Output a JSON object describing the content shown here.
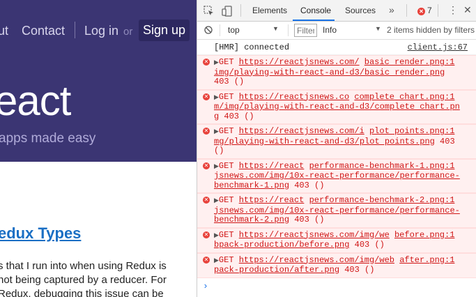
{
  "site": {
    "nav": {
      "about": "ut",
      "contact": "Contact",
      "login": "Log in",
      "or": "or",
      "signup": "Sign up"
    },
    "hero_title": "eact",
    "hero_subtitle": "apps made easy",
    "post_title": "edux Types",
    "post_lines": [
      "s that I run into when using Redux is",
      "not being captured by a reducer. For",
      "Redux, debugging this issue can be"
    ]
  },
  "devtools": {
    "tabs": [
      "Elements",
      "Console",
      "Sources"
    ],
    "active_tab": "Console",
    "more_tabs": "»",
    "error_count": "7",
    "context": "top",
    "filter_placeholder": "Filter",
    "level": "Info",
    "hidden_info": "2 items hidden by filters",
    "log": {
      "text": "[HMR] connected",
      "source": "client.js:67"
    },
    "errors": [
      {
        "lines": [
          [
            {
              "t": "GET "
            },
            {
              "t": "https://reactjsnews.com/",
              "u": true
            },
            {
              "t": " "
            },
            {
              "t": "basic render.png:1",
              "u": true
            }
          ],
          [
            {
              "t": "img/playing-with-react-and-d3/basic render.png",
              "u": true
            }
          ],
          [
            {
              "t": "403 ()"
            }
          ]
        ]
      },
      {
        "lines": [
          [
            {
              "t": "GET "
            },
            {
              "t": "https://reactjsnews.co",
              "u": true
            },
            {
              "t": " "
            },
            {
              "t": "complete chart.png:1",
              "u": true
            }
          ],
          [
            {
              "t": "m/img/playing-with-react-and-d3/complete chart.pn",
              "u": true
            }
          ],
          [
            {
              "t": "g",
              "u": true
            },
            {
              "t": " 403 ()"
            }
          ]
        ]
      },
      {
        "lines": [
          [
            {
              "t": "GET "
            },
            {
              "t": "https://reactjsnews.com/i",
              "u": true
            },
            {
              "t": " "
            },
            {
              "t": "plot points.png:1",
              "u": true
            }
          ],
          [
            {
              "t": "mg/playing-with-react-and-d3/plot points.png",
              "u": true
            },
            {
              "t": " 403"
            }
          ],
          [
            {
              "t": "()"
            }
          ]
        ]
      },
      {
        "lines": [
          [
            {
              "t": "GET "
            },
            {
              "t": "https://react",
              "u": true
            },
            {
              "t": " "
            },
            {
              "t": "performance-benchmark-1.png:1",
              "u": true
            }
          ],
          [
            {
              "t": "jsnews.com/img/10x-react-performance/performance-",
              "u": true
            }
          ],
          [
            {
              "t": "benchmark-1.png",
              "u": true
            },
            {
              "t": " 403 ()"
            }
          ]
        ]
      },
      {
        "lines": [
          [
            {
              "t": "GET "
            },
            {
              "t": "https://react",
              "u": true
            },
            {
              "t": " "
            },
            {
              "t": "performance-benchmark-2.png:1",
              "u": true
            }
          ],
          [
            {
              "t": "jsnews.com/img/10x-react-performance/performance-",
              "u": true
            }
          ],
          [
            {
              "t": "benchmark-2.png",
              "u": true
            },
            {
              "t": " 403 ()"
            }
          ]
        ]
      },
      {
        "lines": [
          [
            {
              "t": "GET "
            },
            {
              "t": "https://reactjsnews.com/img/we",
              "u": true
            },
            {
              "t": " "
            },
            {
              "t": "before.png:1",
              "u": true
            }
          ],
          [
            {
              "t": "bpack-production/before.png",
              "u": true
            },
            {
              "t": " 403 ()"
            }
          ]
        ]
      },
      {
        "lines": [
          [
            {
              "t": "GET "
            },
            {
              "t": "https://reactjsnews.com/img/web",
              "u": true
            },
            {
              "t": " "
            },
            {
              "t": "after.png:1",
              "u": true
            }
          ],
          [
            {
              "t": "pack-production/after.png",
              "u": true
            },
            {
              "t": " 403 ()"
            }
          ]
        ]
      }
    ],
    "prompt": "›"
  }
}
